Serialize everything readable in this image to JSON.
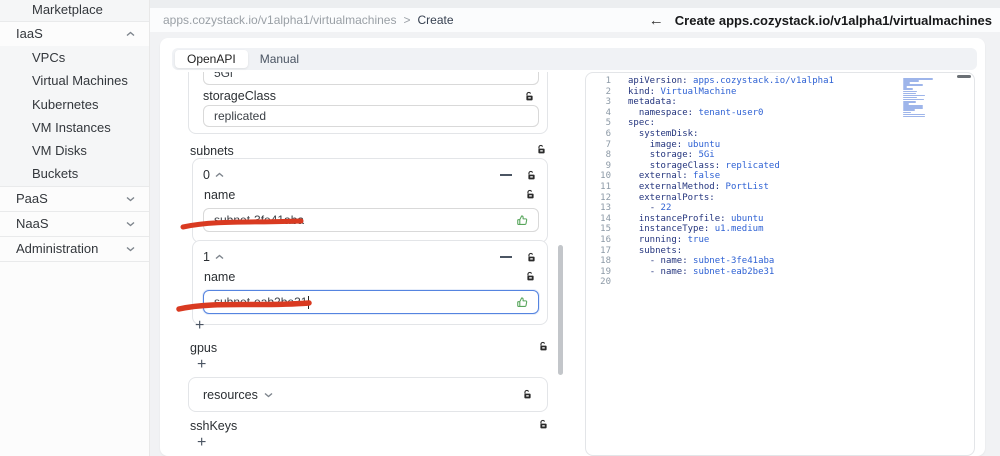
{
  "sidebar": {
    "items": [
      {
        "label": "Marketplace",
        "type": "child"
      },
      {
        "label": "IaaS",
        "type": "group",
        "expanded": true,
        "children": [
          "VPCs",
          "Virtual Machines",
          "Kubernetes",
          "VM Instances",
          "VM Disks",
          "Buckets"
        ]
      },
      {
        "label": "PaaS",
        "type": "group",
        "expanded": false,
        "children": []
      },
      {
        "label": "NaaS",
        "type": "group",
        "expanded": false,
        "children": []
      },
      {
        "label": "Administration",
        "type": "group",
        "expanded": false,
        "children": []
      }
    ]
  },
  "header": {
    "breadcrumb_path": "apps.cozystack.io/v1alpha1/virtualmachines",
    "breadcrumb_sep": ">",
    "breadcrumb_current": "Create",
    "back_icon": "arrow-left",
    "page_title": "Create apps.cozystack.io/v1alpha1/virtualmachines"
  },
  "tabs": {
    "openapi": "OpenAPI",
    "manual": "Manual"
  },
  "form": {
    "top_partial_value": "5Gi",
    "storage_class_label": "storageClass",
    "storage_class_value": "replicated",
    "subnets_label": "subnets",
    "subnet_items": [
      {
        "index": "0",
        "field_label": "name",
        "value": "subnet-3fe41aba",
        "focused": false
      },
      {
        "index": "1",
        "field_label": "name",
        "value": "subnet-eab2be31",
        "focused": true
      }
    ],
    "add_button": "+",
    "gpus_label": "gpus",
    "resources_label": "resources",
    "sshkeys_label": "sshKeys"
  },
  "editor": {
    "lines": [
      {
        "n": "1",
        "segs": [
          [
            "k",
            "apiVersion:"
          ],
          [
            "v",
            " apps.cozystack.io/v1alpha1"
          ]
        ]
      },
      {
        "n": "2",
        "segs": [
          [
            "k",
            "kind:"
          ],
          [
            "v",
            " VirtualMachine"
          ]
        ]
      },
      {
        "n": "3",
        "segs": [
          [
            "k",
            "metadata:"
          ]
        ]
      },
      {
        "n": "4",
        "segs": [
          [
            "p",
            "  "
          ],
          [
            "k",
            "namespace:"
          ],
          [
            "v",
            " tenant-user0"
          ]
        ]
      },
      {
        "n": "5",
        "segs": [
          [
            "k",
            "spec:"
          ]
        ]
      },
      {
        "n": "6",
        "segs": [
          [
            "p",
            "  "
          ],
          [
            "k",
            "systemDisk:"
          ]
        ]
      },
      {
        "n": "7",
        "segs": [
          [
            "p",
            "    "
          ],
          [
            "k",
            "image:"
          ],
          [
            "v",
            " ubuntu"
          ]
        ]
      },
      {
        "n": "8",
        "segs": [
          [
            "p",
            "    "
          ],
          [
            "k",
            "storage:"
          ],
          [
            "v",
            " 5Gi"
          ]
        ]
      },
      {
        "n": "9",
        "segs": [
          [
            "p",
            "    "
          ],
          [
            "k",
            "storageClass:"
          ],
          [
            "v",
            " replicated"
          ]
        ]
      },
      {
        "n": "10",
        "segs": [
          [
            "p",
            "  "
          ],
          [
            "k",
            "external:"
          ],
          [
            "b",
            " false"
          ]
        ]
      },
      {
        "n": "11",
        "segs": [
          [
            "p",
            "  "
          ],
          [
            "k",
            "externalMethod:"
          ],
          [
            "v",
            " PortList"
          ]
        ]
      },
      {
        "n": "12",
        "segs": [
          [
            "p",
            "  "
          ],
          [
            "k",
            "externalPorts:"
          ]
        ]
      },
      {
        "n": "13",
        "segs": [
          [
            "p",
            "    "
          ],
          [
            "d",
            "- "
          ],
          [
            "nu",
            "22"
          ]
        ]
      },
      {
        "n": "14",
        "segs": [
          [
            "p",
            "  "
          ],
          [
            "k",
            "instanceProfile:"
          ],
          [
            "v",
            " ubuntu"
          ]
        ]
      },
      {
        "n": "15",
        "segs": [
          [
            "p",
            "  "
          ],
          [
            "k",
            "instanceType:"
          ],
          [
            "v",
            " u1.medium"
          ]
        ]
      },
      {
        "n": "16",
        "segs": [
          [
            "p",
            "  "
          ],
          [
            "k",
            "running:"
          ],
          [
            "b",
            " true"
          ]
        ]
      },
      {
        "n": "17",
        "segs": [
          [
            "p",
            "  "
          ],
          [
            "k",
            "subnets:"
          ]
        ]
      },
      {
        "n": "18",
        "segs": [
          [
            "p",
            "    "
          ],
          [
            "d",
            "- "
          ],
          [
            "k",
            "name:"
          ],
          [
            "v",
            " subnet-3fe41aba"
          ]
        ]
      },
      {
        "n": "19",
        "segs": [
          [
            "p",
            "    "
          ],
          [
            "d",
            "- "
          ],
          [
            "k",
            "name:"
          ],
          [
            "v",
            " subnet-eab2be31"
          ]
        ]
      },
      {
        "n": "20",
        "segs": []
      }
    ]
  },
  "colors": {
    "accent": "#5584e0",
    "yaml_key": "#24357e",
    "yaml_value": "#2f62d4",
    "annotation_red": "#d93a21",
    "thumb_green": "#58a65c"
  }
}
